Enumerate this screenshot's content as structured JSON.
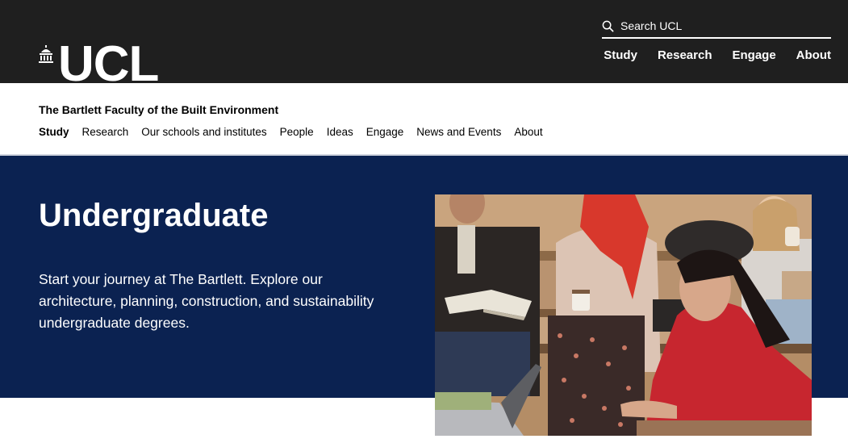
{
  "masthead": {
    "logo_text": "UCL",
    "search_label": "Search UCL",
    "nav": [
      "Study",
      "Research",
      "Engage",
      "About"
    ]
  },
  "faculty": {
    "title": "The Bartlett Faculty of the Built Environment",
    "nav": [
      "Study",
      "Research",
      "Our schools and institutes",
      "People",
      "Ideas",
      "Engage",
      "News and Events",
      "About"
    ],
    "active": "Study"
  },
  "hero": {
    "title": "Undergraduate",
    "description": "Start your journey at The Bartlett. Explore our architecture, planning, construction, and sustainability undergraduate degrees."
  },
  "colors": {
    "masthead_bg": "#1f1f1f",
    "hero_bg": "#0b2251",
    "text_on_dark": "#ffffff"
  },
  "photo": {
    "subject": "students-studying-photo"
  }
}
